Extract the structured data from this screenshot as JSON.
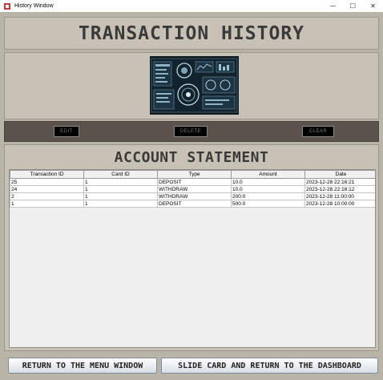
{
  "window": {
    "title": "History Window",
    "controls": {
      "minimize": "—",
      "maximize": "☐",
      "close": "✕"
    }
  },
  "header": {
    "title": "TRANSACTION HISTORY"
  },
  "actions": {
    "edit_label": "EDIT",
    "delete_label": "DELETE",
    "clear_label": "CLEAR"
  },
  "statement": {
    "title": "ACCOUNT STATEMENT",
    "columns": [
      "Transaction ID",
      "Card ID",
      "Type",
      "Amount",
      "Date"
    ],
    "rows": [
      [
        "25",
        "1",
        "DEPOSIT",
        "10.0",
        "2023-12-28 22:16:21"
      ],
      [
        "24",
        "1",
        "WITHDRAW",
        "10.0",
        "2023-12-28 22:16:12"
      ],
      [
        "2",
        "1",
        "WITHDRAW",
        "200.0",
        "2023-12-28 11:00:00"
      ],
      [
        "1",
        "1",
        "DEPOSIT",
        "500.0",
        "2023-12-28 10:00:00"
      ]
    ]
  },
  "footer": {
    "menu_label": "RETURN TO THE MENU WINDOW",
    "slide_label": "SLIDE CARD AND RETURN TO THE DASHBOARD"
  },
  "colors": {
    "panel": "#c7c2b5",
    "background": "#b9b4a8",
    "action_bar": "#5a524b"
  }
}
